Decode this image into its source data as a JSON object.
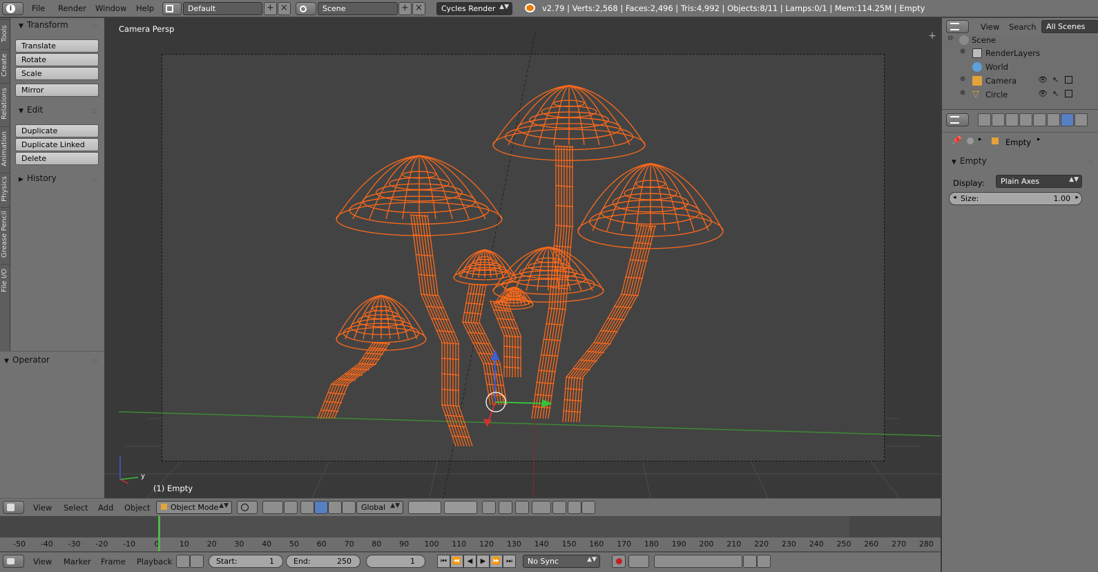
{
  "topbar": {
    "menus": [
      "File",
      "Render",
      "Window",
      "Help"
    ],
    "layout": "Default",
    "scene": "Scene",
    "engine": "Cycles Render",
    "stats": "v2.79 | Verts:2,568 | Faces:2,496 | Tris:4,992 | Objects:8/11 | Lamps:0/1 | Mem:114.25M | Empty"
  },
  "tool_tabs": [
    "Tools",
    "Create",
    "Relations",
    "Animation",
    "Physics",
    "Grease Pencil",
    "File I/O"
  ],
  "toolshelf": {
    "transform": {
      "title": "Transform",
      "buttons": [
        "Translate",
        "Rotate",
        "Scale",
        "Mirror"
      ]
    },
    "edit": {
      "title": "Edit",
      "buttons": [
        "Duplicate",
        "Duplicate Linked",
        "Delete"
      ]
    },
    "history": "History",
    "operator": "Operator"
  },
  "viewport": {
    "label": "Camera Persp",
    "object": "(1) Empty",
    "wire_color": "#ff6a1a",
    "axis_y": "y"
  },
  "view3d_header": {
    "menus": [
      "View",
      "Select",
      "Add",
      "Object"
    ],
    "mode": "Object Mode",
    "orientation": "Global"
  },
  "timeline": {
    "ticks": [
      -50,
      -40,
      -30,
      -20,
      -10,
      0,
      10,
      20,
      30,
      40,
      50,
      60,
      70,
      80,
      90,
      100,
      110,
      120,
      130,
      140,
      150,
      160,
      170,
      180,
      190,
      200,
      210,
      220,
      230,
      240,
      250,
      260,
      270,
      280
    ],
    "current_frame": 0,
    "menus": [
      "View",
      "Marker",
      "Frame",
      "Playback"
    ],
    "start_label": "Start:",
    "start": "1",
    "end_label": "End:",
    "end": "250",
    "frame": "1",
    "sync": "No Sync"
  },
  "outliner": {
    "menus": [
      "View",
      "Search"
    ],
    "filter": "All Scenes",
    "items": [
      {
        "name": "Scene",
        "icon": "scene-icon"
      },
      {
        "name": "RenderLayers",
        "icon": "renderlayers-icon"
      },
      {
        "name": "World",
        "icon": "world-icon"
      },
      {
        "name": "Camera",
        "icon": "camera-icon"
      },
      {
        "name": "Circle",
        "icon": "curve-icon"
      }
    ]
  },
  "properties": {
    "breadcrumb": "Empty",
    "panel_title": "Empty",
    "display_label": "Display:",
    "display_value": "Plain Axes",
    "size_label": "Size:",
    "size_value": "1.00"
  }
}
